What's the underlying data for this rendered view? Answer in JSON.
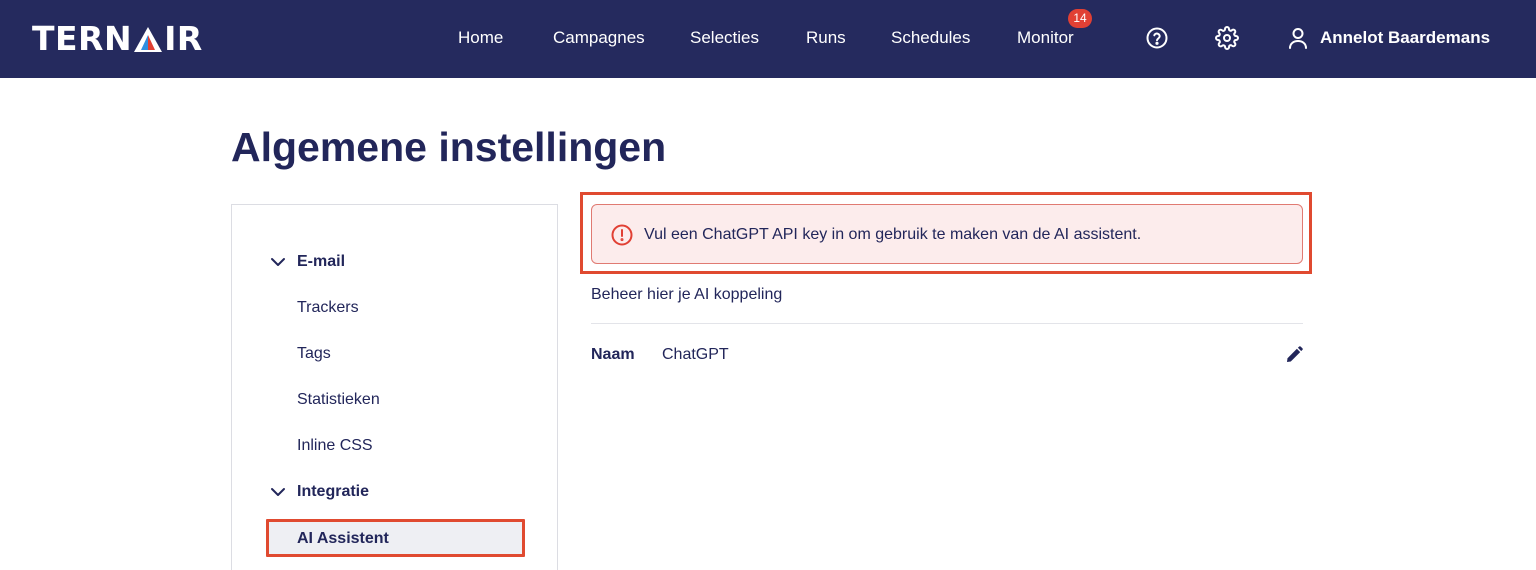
{
  "brand": {
    "logo_left": "TERN",
    "logo_right": "IR"
  },
  "nav": {
    "items": [
      {
        "label": "Home"
      },
      {
        "label": "Campagnes"
      },
      {
        "label": "Selecties"
      },
      {
        "label": "Runs"
      },
      {
        "label": "Schedules"
      },
      {
        "label": "Monitor"
      }
    ],
    "monitor_badge": "14",
    "help_icon": "help-circle-icon",
    "settings_icon": "gear-icon",
    "user_icon": "user-icon",
    "user_name": "Annelot Baardemans"
  },
  "page": {
    "title": "Algemene instellingen"
  },
  "sidebar": {
    "groups": [
      {
        "label": "E-mail",
        "items": [
          {
            "label": "Trackers"
          },
          {
            "label": "Tags"
          },
          {
            "label": "Statistieken"
          },
          {
            "label": "Inline CSS"
          }
        ]
      },
      {
        "label": "Integratie",
        "items": [
          {
            "label": "AI Assistent",
            "active": true
          }
        ]
      }
    ]
  },
  "alert": {
    "icon": "alert-circle-icon",
    "text": "Vul een ChatGPT API key in om gebruik te maken van de AI assistent."
  },
  "content": {
    "subtitle": "Beheer hier je AI koppeling",
    "fields": [
      {
        "label": "Naam",
        "value": "ChatGPT"
      }
    ],
    "edit_icon": "pencil-icon"
  },
  "colors": {
    "navbar": "#252a5e",
    "text": "#22265a",
    "badge": "#e14034",
    "highlight_outline": "#e04a30",
    "alert_background": "#fcecec",
    "alert_border": "#e07a72",
    "logo_triangle_red": "#e14034",
    "logo_triangle_blue": "#2f8ee0"
  }
}
